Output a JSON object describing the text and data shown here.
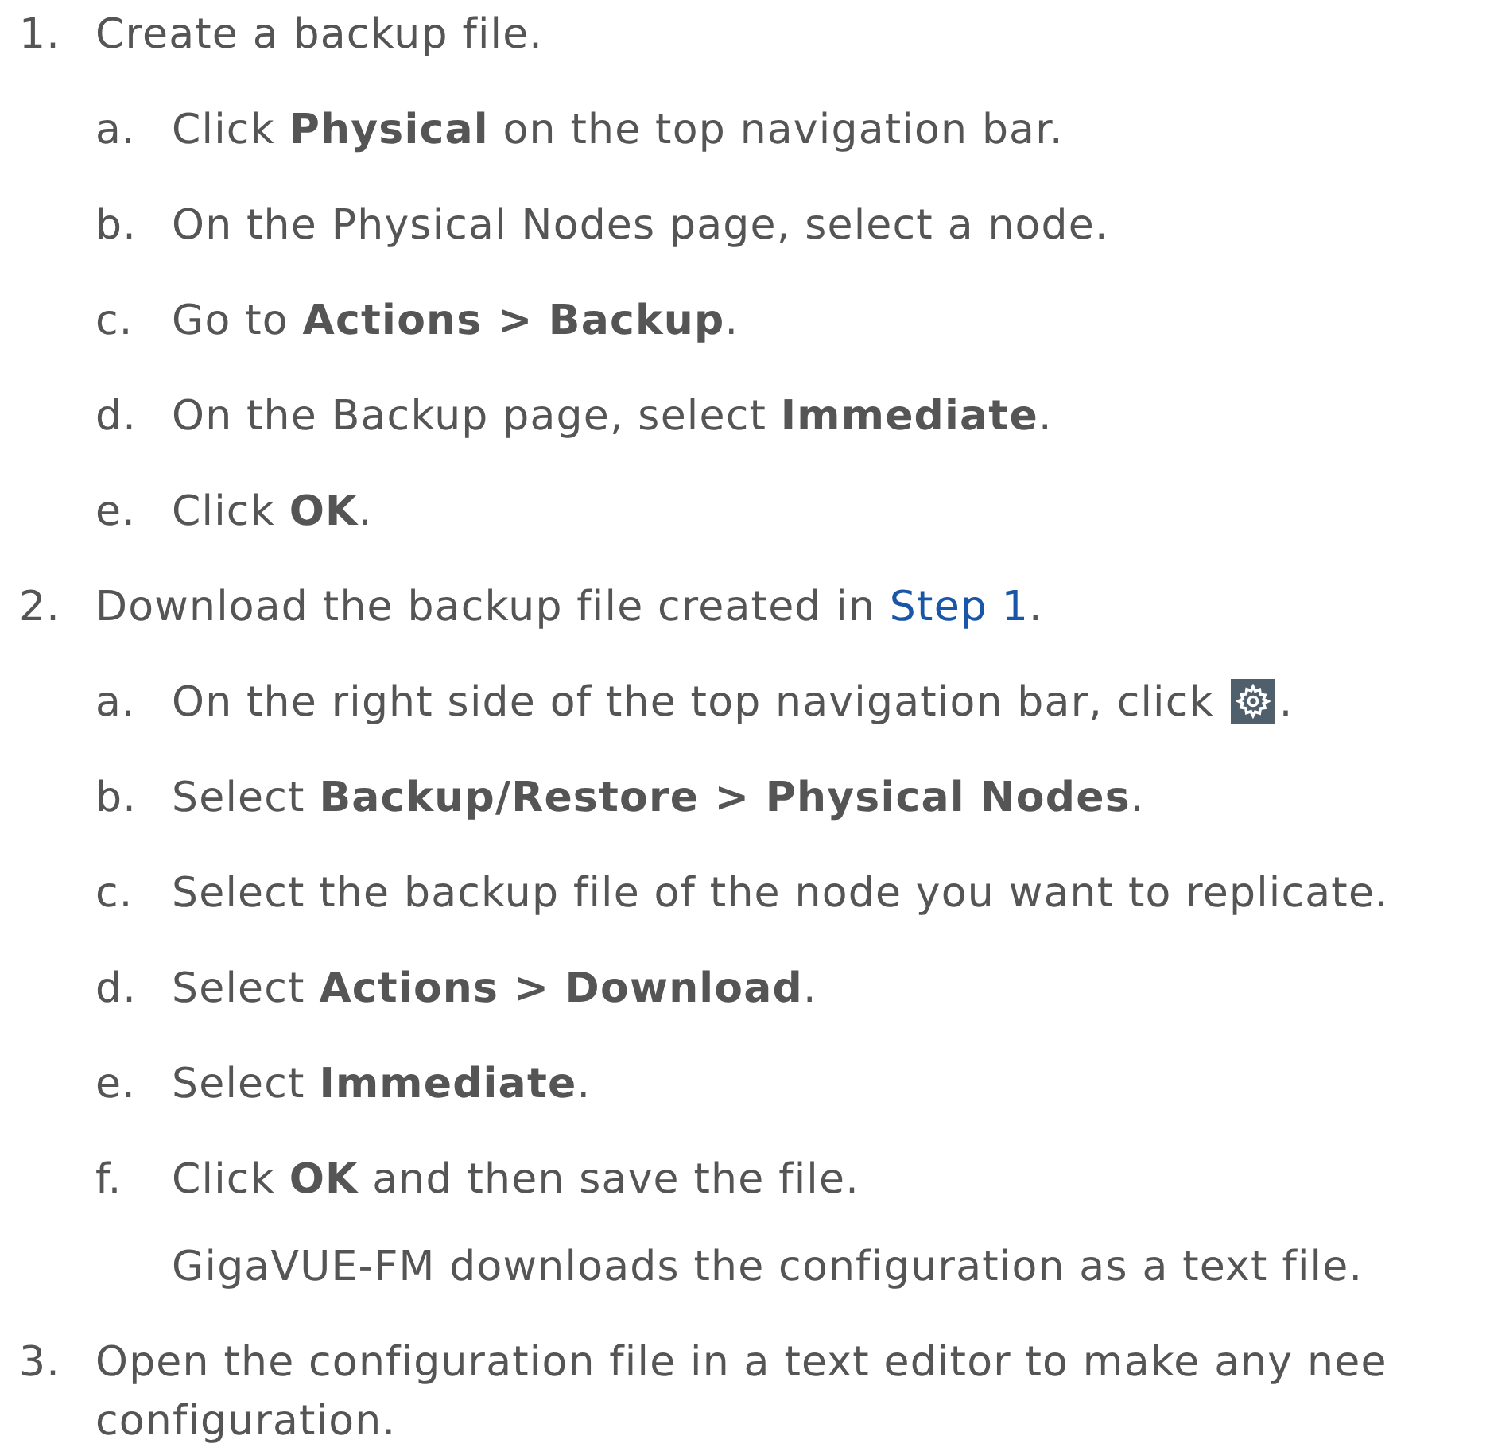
{
  "steps": [
    {
      "number": "1.",
      "lines": [
        [
          {
            "kind": "text",
            "text": "Create a backup file."
          }
        ]
      ],
      "substeps": [
        {
          "letter": "a.",
          "parts": [
            {
              "kind": "text",
              "text": "Click **Physical** on the top navigation bar."
            }
          ]
        },
        {
          "letter": "b.",
          "parts": [
            {
              "kind": "text",
              "text": "On the Physical Nodes page, select a node."
            }
          ]
        },
        {
          "letter": "c.",
          "parts": [
            {
              "kind": "text",
              "text": "Go to **Actions > Backup**."
            }
          ]
        },
        {
          "letter": "d.",
          "parts": [
            {
              "kind": "text",
              "text": "On the Backup page, select **Immediate**."
            }
          ]
        },
        {
          "letter": "e.",
          "parts": [
            {
              "kind": "text",
              "text": "Click **OK**."
            }
          ]
        }
      ]
    },
    {
      "number": "2.",
      "lines": [
        [
          {
            "kind": "text",
            "text": "Download the backup file created in"
          },
          {
            "kind": "link",
            "text": "Step 1"
          },
          {
            "kind": "text",
            "text": "."
          }
        ]
      ],
      "substeps": [
        {
          "letter": "a.",
          "parts": [
            {
              "kind": "text",
              "text": "On the right side of the top navigation bar, click"
            },
            {
              "kind": "icon"
            },
            {
              "kind": "text",
              "text": "."
            }
          ]
        },
        {
          "letter": "b.",
          "parts": [
            {
              "kind": "text",
              "text": "Select **Backup/Restore > Physical Nodes**."
            }
          ]
        },
        {
          "letter": "c.",
          "parts": [
            {
              "kind": "text",
              "text": "Select the backup file of the node you want to replicate."
            }
          ]
        },
        {
          "letter": "d.",
          "parts": [
            {
              "kind": "text",
              "text": "Select **Actions > Download**."
            }
          ]
        },
        {
          "letter": "e.",
          "parts": [
            {
              "kind": "text",
              "text": "Select **Immediate**."
            }
          ]
        },
        {
          "letter": "f.",
          "parts": [
            {
              "kind": "text",
              "text": "Click **OK** and then save the file."
            }
          ],
          "note": "GigaVUE-FM downloads the configuration as a text file."
        }
      ]
    },
    {
      "number": "3.",
      "lines": [
        [
          {
            "kind": "text",
            "text": "Open the configuration file in a text editor to make any nee"
          }
        ],
        [
          {
            "kind": "text",
            "text": "configuration."
          }
        ]
      ]
    }
  ]
}
